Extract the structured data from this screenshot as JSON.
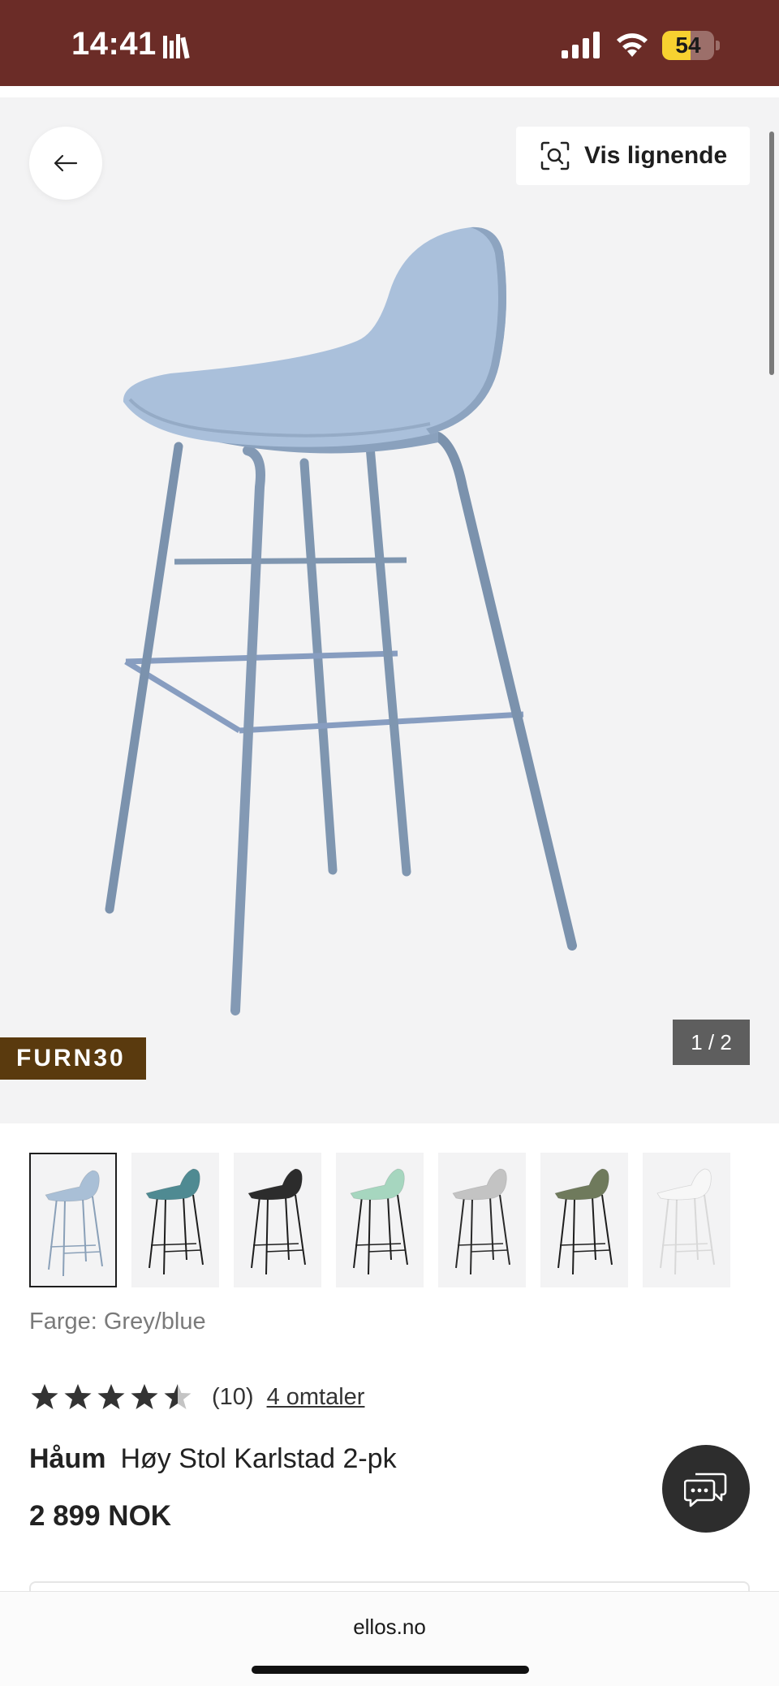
{
  "status_bar": {
    "time": "14:41",
    "battery_percent": 54,
    "battery_label": "54",
    "background": "#6b2c27",
    "icons": [
      "library-icon",
      "signal-icon",
      "wifi-icon",
      "battery-icon"
    ]
  },
  "gallery": {
    "similar_label": "Vis lignende",
    "promo_code": "FURN30",
    "counter": "1 / 2",
    "background": "#f3f3f4"
  },
  "thumbnails": [
    {
      "color_name": "Grey/blue",
      "seat": "#a9bfd6",
      "legs": "#8aa0b8",
      "selected": true
    },
    {
      "color_name": "Teal",
      "seat": "#4f8a92",
      "legs": "#1e1e1e",
      "selected": false
    },
    {
      "color_name": "Black",
      "seat": "#2c2c2c",
      "legs": "#1e1e1e",
      "selected": false
    },
    {
      "color_name": "Mint",
      "seat": "#a6d6bf",
      "legs": "#1e1e1e",
      "selected": false
    },
    {
      "color_name": "Light grey",
      "seat": "#c3c3c3",
      "legs": "#2a2a2a",
      "selected": false
    },
    {
      "color_name": "Olive",
      "seat": "#6f7a5c",
      "legs": "#1e1e1e",
      "selected": false
    },
    {
      "color_name": "White",
      "seat": "#f7f7f7",
      "legs": "#d8d8d8",
      "selected": false
    }
  ],
  "product": {
    "color_label": "Farge: Grey/blue",
    "rating": 4.5,
    "rating_count": "(10)",
    "reviews_link": "4 omtaler",
    "brand": "Håum",
    "name": "Høy Stol Karlstad 2-pk",
    "price": "2 899 NOK"
  },
  "browser": {
    "url": "ellos.no"
  }
}
